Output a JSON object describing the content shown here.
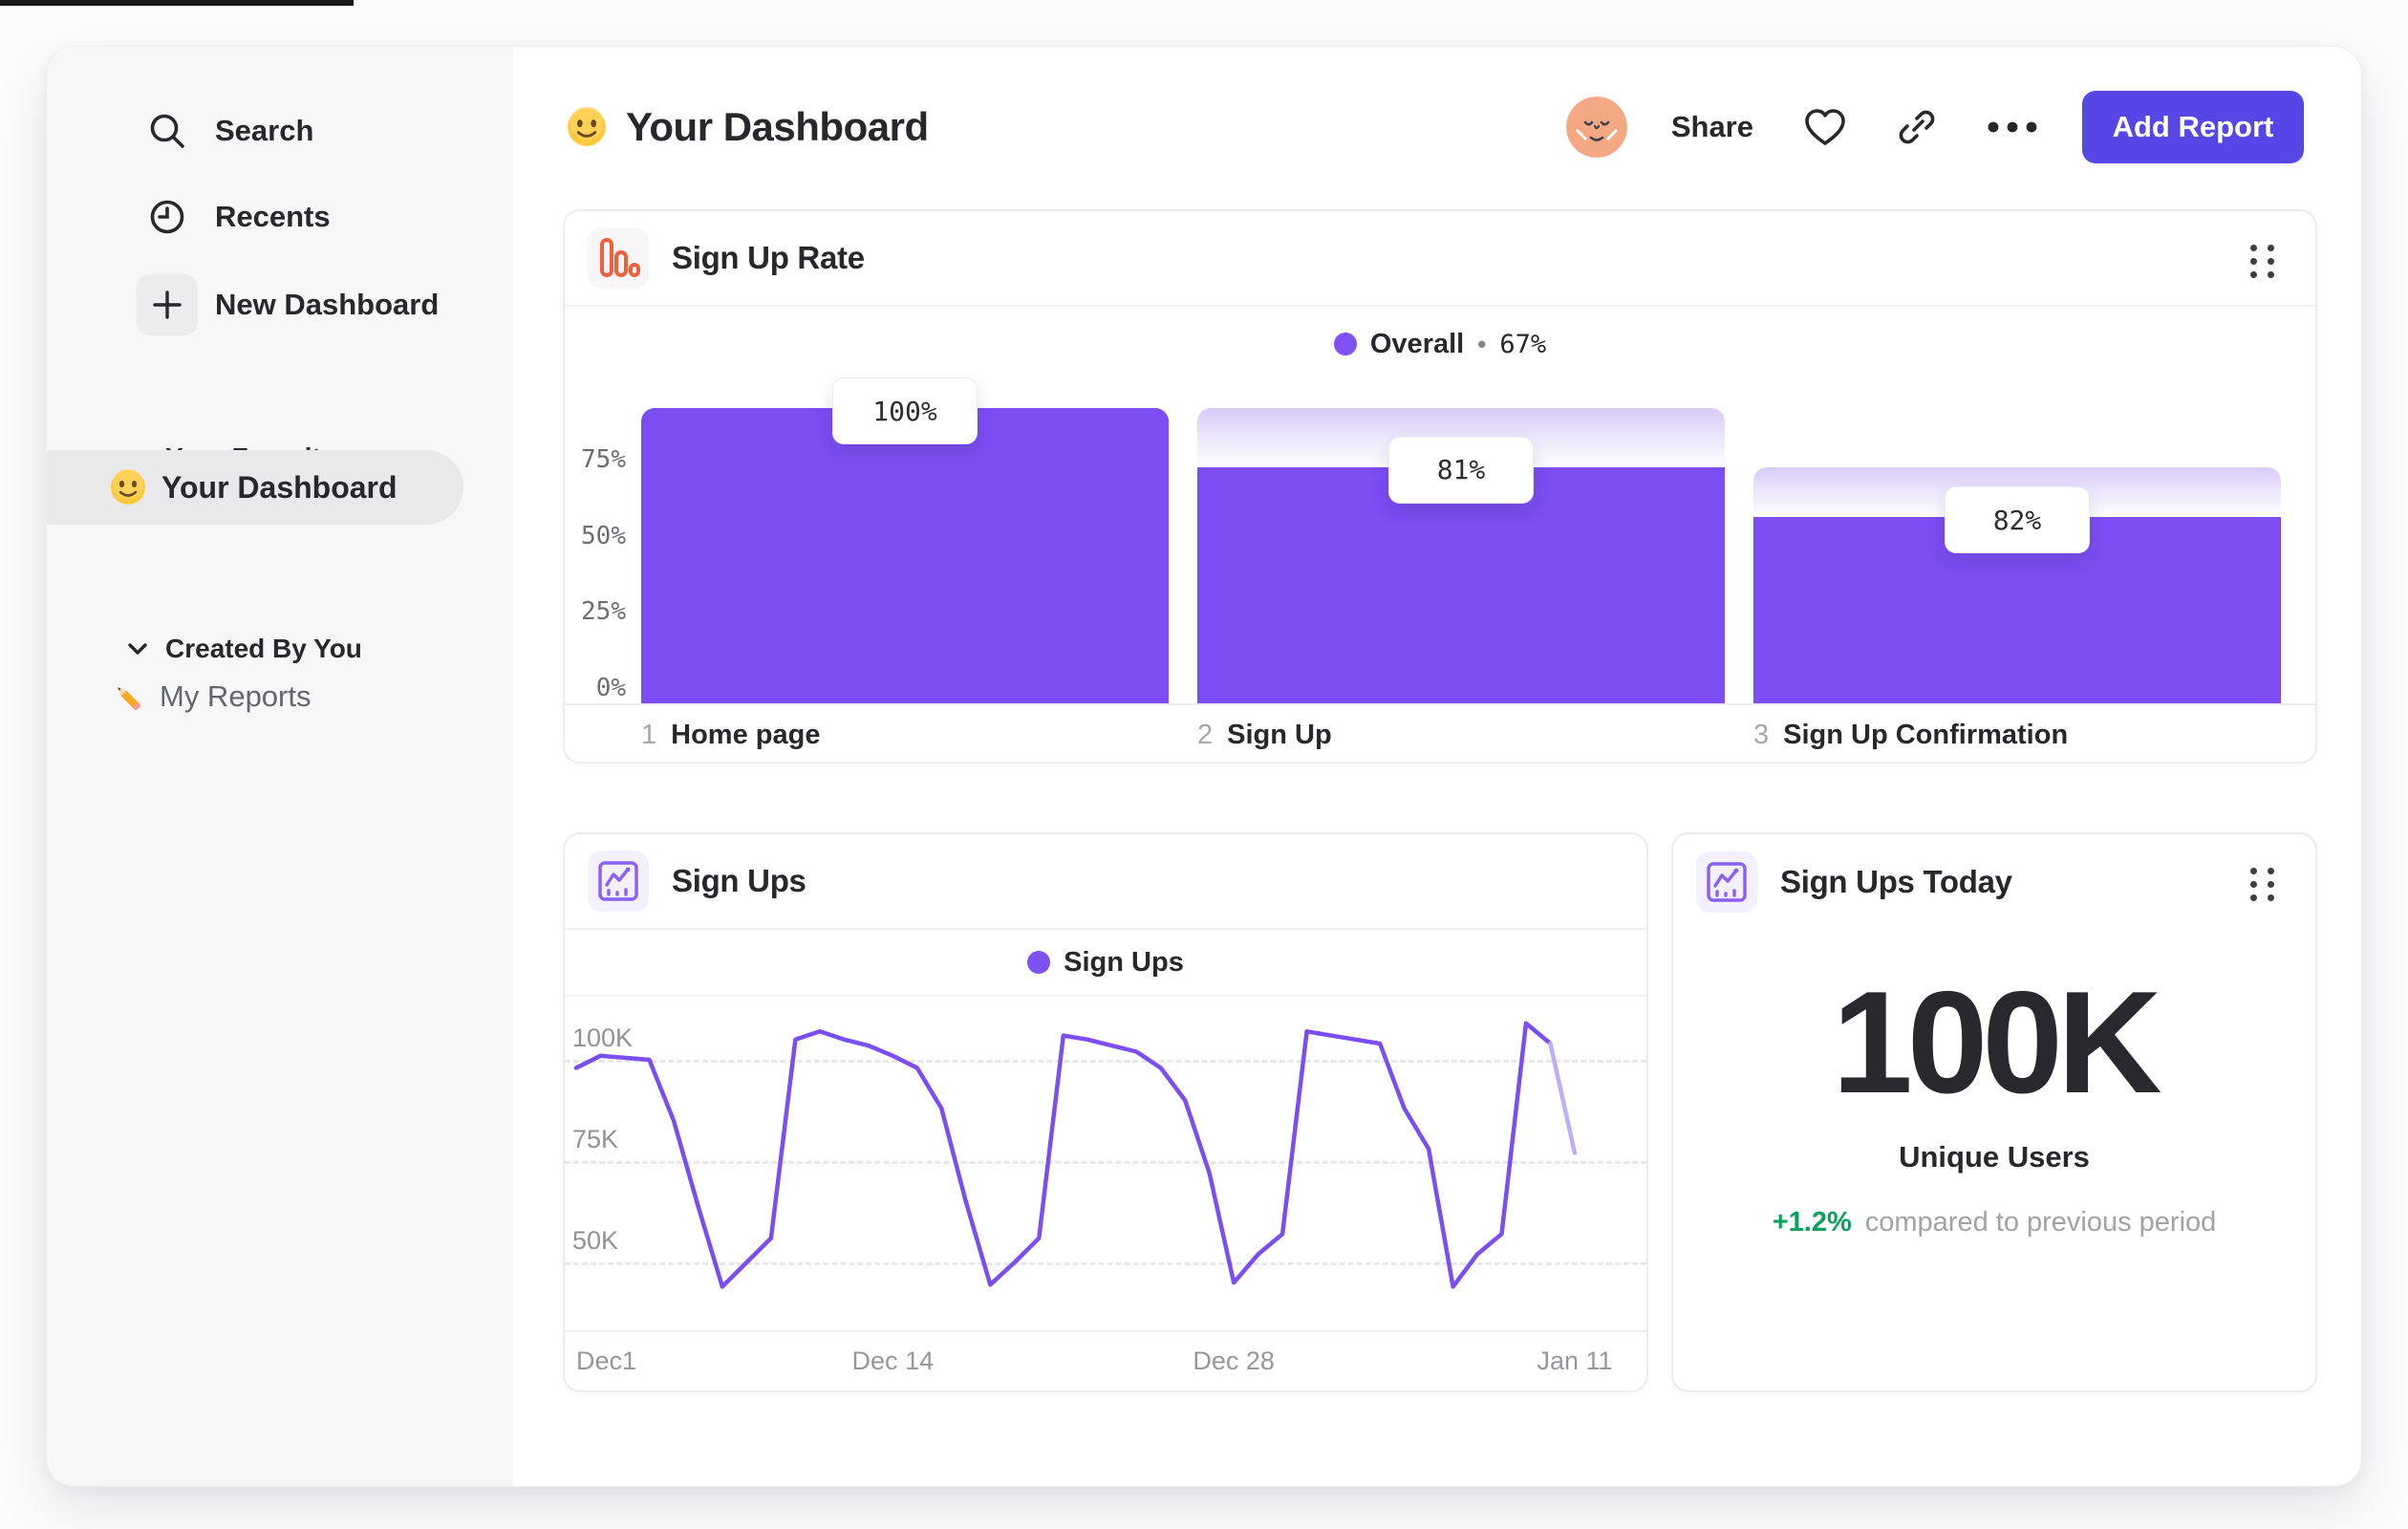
{
  "sidebar": {
    "items": [
      {
        "label": "Search",
        "icon": "search-icon"
      },
      {
        "label": "Recents",
        "icon": "clock-icon"
      },
      {
        "label": "New Dashboard",
        "icon": "plus-icon"
      }
    ],
    "sections": [
      {
        "label": "Your Favorites",
        "items": [
          {
            "label": "Your Dashboard",
            "icon": "smiley-emoji",
            "selected": true
          }
        ]
      },
      {
        "label": "Created By You",
        "items": [
          {
            "label": "My Reports",
            "icon": "pencil-emoji",
            "selected": false
          }
        ]
      }
    ]
  },
  "header": {
    "title": "Your Dashboard",
    "share_label": "Share",
    "add_report_label": "Add Report"
  },
  "today_card": {
    "title": "Sign Ups Today",
    "value": "100K",
    "label": "Unique Users",
    "delta": "+1.2%",
    "delta_note": "compared to previous period",
    "delta_color": "#0aa15c"
  },
  "chart_data": [
    {
      "type": "bar",
      "subtype": "funnel",
      "title": "Sign Up Rate",
      "legend": {
        "label": "Overall",
        "separator": "•",
        "value": "67%"
      },
      "overall_pct": 67,
      "steps": [
        {
          "num": "1",
          "label": "Home page",
          "display": "100%",
          "step_conversion_pct": 100,
          "cumulative_pct": 100,
          "prev_pct": 100
        },
        {
          "num": "2",
          "label": "Sign Up",
          "display": "81%",
          "step_conversion_pct": 81,
          "cumulative_pct": 80,
          "prev_pct": 100
        },
        {
          "num": "3",
          "label": "Sign Up Confirmation",
          "display": "82%",
          "step_conversion_pct": 82,
          "cumulative_pct": 63,
          "prev_pct": 80
        }
      ],
      "y_ticks": [
        "75%",
        "50%",
        "25%",
        "0%"
      ],
      "ylim": [
        0,
        105
      ],
      "grid": false,
      "legend_position": "top-center",
      "bar_color": "#7b4df2",
      "cap_gradient": [
        "#d7cbf8",
        "#fdfdff"
      ]
    },
    {
      "type": "line",
      "title": "Sign Ups",
      "legend": {
        "label": "Sign Ups"
      },
      "x_ticks": [
        {
          "label": "Dec1",
          "day": 0
        },
        {
          "label": "Dec 14",
          "day": 13
        },
        {
          "label": "Dec 28",
          "day": 27
        },
        {
          "label": "Jan 11",
          "day": 41
        }
      ],
      "y_ticks": [
        {
          "label": "100K",
          "value": 100
        },
        {
          "label": "75K",
          "value": 75
        },
        {
          "label": "50K",
          "value": 50
        }
      ],
      "unit": "K sign ups per day",
      "values": [
        98,
        101,
        100.5,
        100,
        85,
        64,
        44,
        50,
        56,
        105,
        107,
        105,
        103.5,
        101,
        98,
        88,
        65,
        44.5,
        50,
        56,
        106,
        105,
        103.5,
        102,
        98,
        90,
        72,
        45,
        52,
        57,
        107,
        106,
        105,
        104,
        88,
        78,
        44,
        52,
        57,
        109,
        104,
        77
      ],
      "faded_tail_segments": 1,
      "line_color": "#7b4df2",
      "faded_color": "#bfaef7",
      "ylim": [
        40,
        112
      ],
      "grid": "dashed-horizontal",
      "legend_position": "top-center"
    }
  ]
}
